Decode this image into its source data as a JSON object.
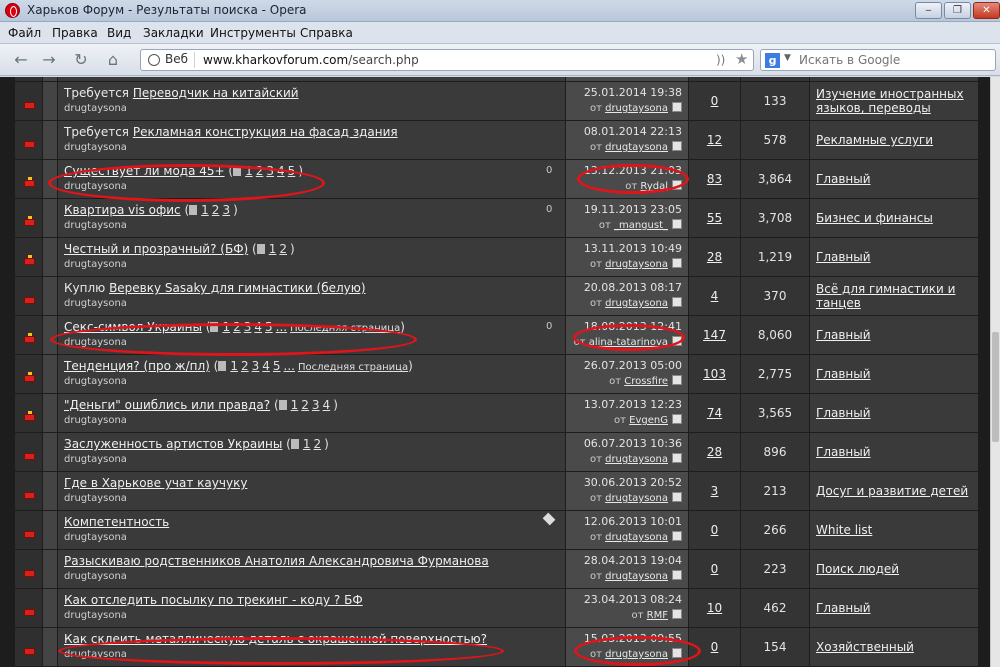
{
  "window": {
    "title": "Харьков Форум - Результаты поиска - Opera"
  },
  "menu": [
    "Файл",
    "Правка",
    "Вид",
    "Закладки",
    "Инструменты",
    "Справка"
  ],
  "address": {
    "web_label": "Веб",
    "url_domain": "www.kharkovforum.com",
    "url_path": "/search.php"
  },
  "search": {
    "placeholder": "Искать в Google"
  },
  "top_cut_author": "drugtaysona",
  "rows": [
    {
      "prefix": "Требуется ",
      "title": "Переводчик на китайский",
      "pages": [],
      "last": "",
      "author": "drugtaysona",
      "date": "25.01.2014 19:38",
      "by": "drugtaysona",
      "replies": "0",
      "views": "133",
      "forum": [
        "Изучение иностранных",
        "языков, переводы"
      ],
      "icon": "folder-icon",
      "attach": ""
    },
    {
      "prefix": "Требуется ",
      "title": "Рекламная конструкция на фасад здания",
      "pages": [],
      "last": "",
      "author": "drugtaysona",
      "date": "08.01.2014 22:13",
      "by": "drugtaysona",
      "replies": "12",
      "views": "578",
      "forum": [
        "Рекламные услуги"
      ],
      "icon": "folder-icon",
      "attach": ""
    },
    {
      "prefix": "",
      "title": "Существует ли мода 45+",
      "pages": [
        "1",
        "2",
        "3",
        "4",
        "5"
      ],
      "last": "",
      "author": "drugtaysona",
      "date": "13.12.2013 21:03",
      "by": "Rydal",
      "replies": "83",
      "views": "3,864",
      "forum": [
        "Главный"
      ],
      "icon": "hot-folder-icon",
      "attach": "0"
    },
    {
      "prefix": "",
      "title": "Квартира vis офис",
      "pages": [
        "1",
        "2",
        "3"
      ],
      "last": "",
      "author": "drugtaysona",
      "date": "19.11.2013 23:05",
      "by": "_mangust_",
      "replies": "55",
      "views": "3,708",
      "forum": [
        "Бизнес и финансы"
      ],
      "icon": "hot-folder-icon",
      "attach": "0"
    },
    {
      "prefix": "",
      "title": "Честный и прозрачный? (БФ)",
      "pages": [
        "1",
        "2"
      ],
      "last": "",
      "author": "drugtaysona",
      "date": "13.11.2013 10:49",
      "by": "drugtaysona",
      "replies": "28",
      "views": "1,219",
      "forum": [
        "Главный"
      ],
      "icon": "hot-folder-icon",
      "attach": ""
    },
    {
      "prefix": "Куплю ",
      "title": "Веревку Sasaky для гимнастики (белую)",
      "pages": [],
      "last": "",
      "author": "drugtaysona",
      "date": "20.08.2013 08:17",
      "by": "drugtaysona",
      "replies": "4",
      "views": "370",
      "forum": [
        "Всё для гимнастики и",
        "танцев"
      ],
      "icon": "folder-icon",
      "attach": ""
    },
    {
      "prefix": "",
      "title": "Секс-символ Украины",
      "pages": [
        "1",
        "2",
        "3",
        "4",
        "5",
        "..."
      ],
      "last": "Последняя страница",
      "author": "drugtaysona",
      "date": "18.08.2013 12:41",
      "by": "alina-tatarinova",
      "replies": "147",
      "views": "8,060",
      "forum": [
        "Главный"
      ],
      "icon": "hot-folder-icon",
      "attach": "0"
    },
    {
      "prefix": "",
      "title": "Тенденция? (про ж/пл)",
      "pages": [
        "1",
        "2",
        "3",
        "4",
        "5",
        "..."
      ],
      "last": "Последняя страница",
      "author": "drugtaysona",
      "date": "26.07.2013 05:00",
      "by": "Crossfire",
      "replies": "103",
      "views": "2,775",
      "forum": [
        "Главный"
      ],
      "icon": "hot-folder-icon",
      "attach": ""
    },
    {
      "prefix": "",
      "title": "\"Деньги\" ошиблись или правда?",
      "pages": [
        "1",
        "2",
        "3",
        "4"
      ],
      "last": "",
      "author": "drugtaysona",
      "date": "13.07.2013 12:23",
      "by": "EvgenG",
      "replies": "74",
      "views": "3,565",
      "forum": [
        "Главный"
      ],
      "icon": "hot-folder-icon",
      "attach": ""
    },
    {
      "prefix": "",
      "title": "Заслуженность артистов Украины",
      "pages": [
        "1",
        "2"
      ],
      "last": "",
      "author": "drugtaysona",
      "date": "06.07.2013 10:36",
      "by": "drugtaysona",
      "replies": "28",
      "views": "896",
      "forum": [
        "Главный"
      ],
      "icon": "folder-icon",
      "attach": ""
    },
    {
      "prefix": "",
      "title": "Где в Харькове учат каучуку",
      "pages": [],
      "last": "",
      "author": "drugtaysona",
      "date": "30.06.2013 20:52",
      "by": "drugtaysona",
      "replies": "3",
      "views": "213",
      "forum": [
        "Досуг и развитие детей"
      ],
      "icon": "folder-icon",
      "attach": ""
    },
    {
      "prefix": "",
      "title": "Компетентность",
      "pages": [],
      "last": "",
      "author": "drugtaysona",
      "date": "12.06.2013 10:01",
      "by": "drugtaysona",
      "replies": "0",
      "views": "266",
      "forum": [
        "White list"
      ],
      "icon": "folder-icon",
      "attach": "tag"
    },
    {
      "prefix": "",
      "title": "Разыскиваю родственников Анатолия Александровича Фурманова",
      "pages": [],
      "last": "",
      "author": "drugtaysona",
      "date": "28.04.2013 19:04",
      "by": "drugtaysona",
      "replies": "0",
      "views": "223",
      "forum": [
        "Поиск людей"
      ],
      "icon": "folder-icon",
      "attach": ""
    },
    {
      "prefix": "",
      "title": "Как отследить посылку по трекинг - коду ? БФ",
      "pages": [],
      "last": "",
      "author": "drugtaysona",
      "date": "23.04.2013 08:24",
      "by": "RMF",
      "replies": "10",
      "views": "462",
      "forum": [
        "Главный"
      ],
      "icon": "folder-icon",
      "attach": ""
    },
    {
      "prefix": "",
      "title": "Как склеить металлическую деталь с окрашенной поверхностью?",
      "pages": [],
      "last": "",
      "author": "drugtaysona",
      "date": "15.03.2013 09:55",
      "by": "drugtaysona",
      "replies": "0",
      "views": "154",
      "forum": [
        "Хозяйственный"
      ],
      "icon": "folder-icon",
      "attach": ""
    }
  ],
  "colors": {
    "highlight": "#e0141b",
    "row_bg": "#3a3a3a",
    "page_bg": "#1d1d1d"
  }
}
